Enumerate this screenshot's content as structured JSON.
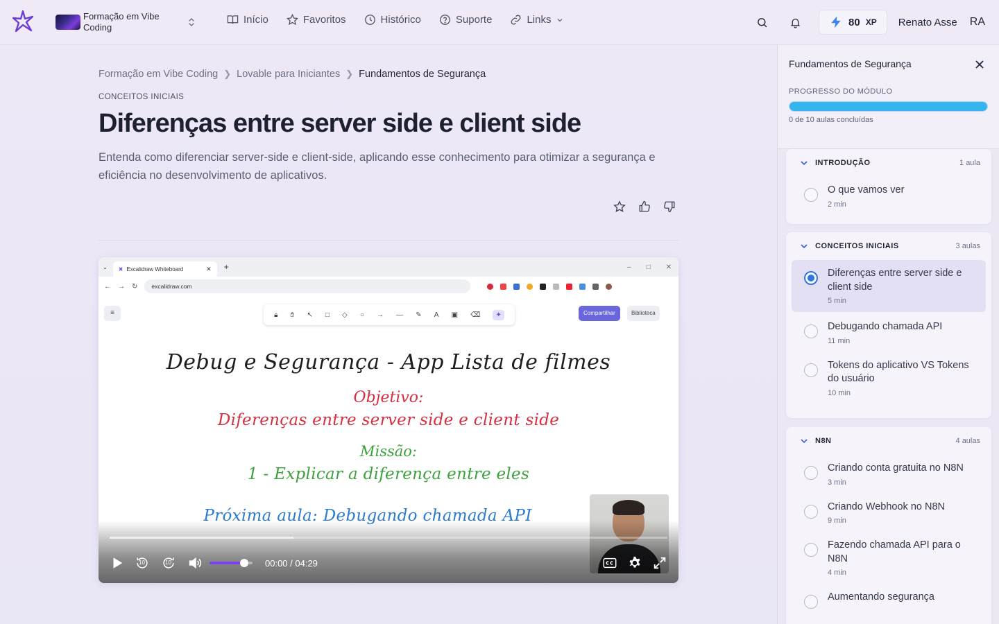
{
  "header": {
    "course_name": "Formação em Vibe Coding",
    "nav": [
      {
        "label": "Início",
        "icon": "book-open-icon"
      },
      {
        "label": "Favoritos",
        "icon": "star-icon"
      },
      {
        "label": "Histórico",
        "icon": "clock-icon"
      },
      {
        "label": "Suporte",
        "icon": "help-circle-icon"
      },
      {
        "label": "Links",
        "icon": "link-icon"
      }
    ],
    "xp_value": "80",
    "xp_unit": "XP",
    "user_name": "Renato Asse",
    "user_initials": "RA",
    "accent": "#3b82f6"
  },
  "breadcrumb": [
    "Formação em Vibe Coding",
    "Lovable para Iniciantes",
    "Fundamentos de Segurança"
  ],
  "lesson": {
    "section": "CONCEITOS INICIAIS",
    "title": "Diferenças entre server side e client side",
    "description": "Entenda como diferenciar server-side e client-side, aplicando esse conhecimento para otimizar a segurança e eficiência no desenvolvimento de aplicativos."
  },
  "video": {
    "browser_tab": "Excalidraw Whiteboard",
    "url": "excalidraw.com",
    "share_label": "Compartilhar",
    "library_label": "Biblioteca",
    "board": {
      "title": "Debug e Segurança - App Lista de filmes",
      "objective_label": "Objetivo:",
      "objective": "Diferenças entre server side e client side",
      "mission_label": "Missão:",
      "mission": "1 - Explicar a diferença entre eles",
      "next": "Próxima aula: Debugando chamada API"
    },
    "time": "00:00 / 04:29",
    "progress": 0.0,
    "buffered": 0.33,
    "volume": 0.8,
    "skip_seconds": "10"
  },
  "sidebar": {
    "title": "Fundamentos de Segurança",
    "progress_label": "PROGRESSO DO MÓDULO",
    "progress_count": "0 de 10 aulas concluídas",
    "progress_fill": 1.0,
    "modules": [
      {
        "name": "INTRODUÇÃO",
        "count": "1 aula",
        "lessons": [
          {
            "name": "O que vamos ver",
            "duration": "2 min",
            "active": false
          }
        ]
      },
      {
        "name": "CONCEITOS INICIAIS",
        "count": "3 aulas",
        "lessons": [
          {
            "name": "Diferenças entre server side e client side",
            "duration": "5 min",
            "active": true
          },
          {
            "name": "Debugando chamada API",
            "duration": "11 min",
            "active": false
          },
          {
            "name": "Tokens do aplicativo VS Tokens do usuário",
            "duration": "10 min",
            "active": false
          }
        ]
      },
      {
        "name": "N8N",
        "count": "4 aulas",
        "lessons": [
          {
            "name": "Criando conta gratuita no N8N",
            "duration": "3 min",
            "active": false
          },
          {
            "name": "Criando Webhook no N8N",
            "duration": "9 min",
            "active": false
          },
          {
            "name": "Fazendo chamada API para o N8N",
            "duration": "4 min",
            "active": false
          },
          {
            "name": "Aumentando segurança",
            "duration": "",
            "active": false
          }
        ]
      }
    ]
  }
}
